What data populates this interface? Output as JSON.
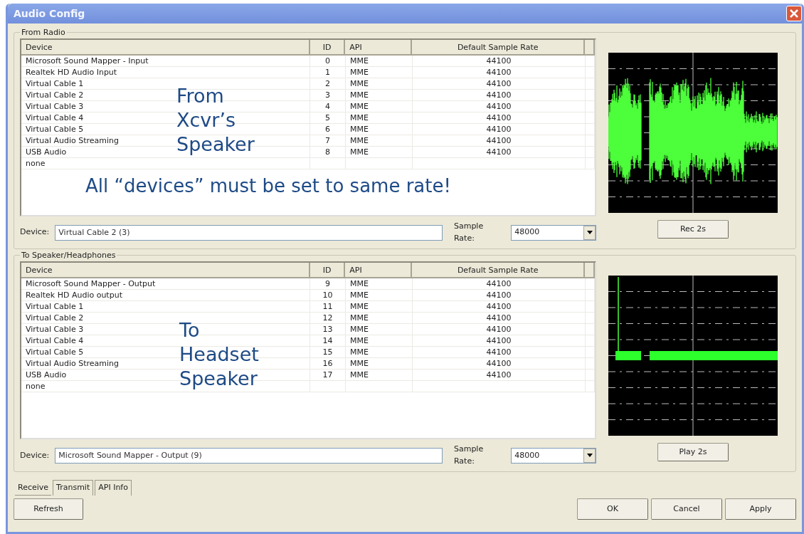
{
  "window": {
    "title": "Audio Config"
  },
  "sections": [
    {
      "title": "From Radio",
      "columns": [
        "Device",
        "ID",
        "API",
        "Default Sample Rate"
      ],
      "rows": [
        {
          "device": "Microsoft Sound Mapper - Input",
          "id": "0",
          "api": "MME",
          "rate": "44100"
        },
        {
          "device": "Realtek HD Audio Input",
          "id": "1",
          "api": "MME",
          "rate": "44100"
        },
        {
          "device": "Virtual Cable 1",
          "id": "2",
          "api": "MME",
          "rate": "44100"
        },
        {
          "device": "Virtual Cable 2",
          "id": "3",
          "api": "MME",
          "rate": "44100"
        },
        {
          "device": "Virtual Cable 3",
          "id": "4",
          "api": "MME",
          "rate": "44100"
        },
        {
          "device": "Virtual Cable 4",
          "id": "5",
          "api": "MME",
          "rate": "44100"
        },
        {
          "device": "Virtual Cable 5",
          "id": "6",
          "api": "MME",
          "rate": "44100"
        },
        {
          "device": "Virtual Audio Streaming",
          "id": "7",
          "api": "MME",
          "rate": "44100"
        },
        {
          "device": "USB Audio",
          "id": "8",
          "api": "MME",
          "rate": "44100"
        },
        {
          "device": "none"
        }
      ],
      "note_lines": [
        "From",
        "Xcvr’s",
        "Speaker"
      ],
      "banner": "All “devices” must be set to same rate!",
      "device_label": "Device:",
      "device_value": "Virtual Cable 2 (3)",
      "rate_label": "Sample Rate:",
      "rate_value": "48000",
      "scope": {
        "kind": "noise"
      },
      "button": "Rec 2s"
    },
    {
      "title": "To Speaker/Headphones",
      "columns": [
        "Device",
        "ID",
        "API",
        "Default Sample Rate"
      ],
      "rows": [
        {
          "device": "Microsoft Sound Mapper - Output",
          "id": "9",
          "api": "MME",
          "rate": "44100"
        },
        {
          "device": "Realtek HD Audio output",
          "id": "10",
          "api": "MME",
          "rate": "44100"
        },
        {
          "device": "Virtual Cable 1",
          "id": "11",
          "api": "MME",
          "rate": "44100"
        },
        {
          "device": "Virtual Cable 2",
          "id": "12",
          "api": "MME",
          "rate": "44100"
        },
        {
          "device": "Virtual Cable 3",
          "id": "13",
          "api": "MME",
          "rate": "44100"
        },
        {
          "device": "Virtual Cable 4",
          "id": "14",
          "api": "MME",
          "rate": "44100"
        },
        {
          "device": "Virtual Cable 5",
          "id": "15",
          "api": "MME",
          "rate": "44100"
        },
        {
          "device": "Virtual Audio Streaming",
          "id": "16",
          "api": "MME",
          "rate": "44100"
        },
        {
          "device": "USB Audio",
          "id": "17",
          "api": "MME",
          "rate": "44100"
        },
        {
          "device": "none"
        }
      ],
      "note_lines": [
        "To",
        "Headset",
        "Speaker"
      ],
      "device_label": "Device:",
      "device_value": "Microsoft Sound Mapper - Output (9)",
      "rate_label": "Sample Rate:",
      "rate_value": "48000",
      "scope": {
        "kind": "flat"
      },
      "button": "Play 2s"
    }
  ],
  "tabs": [
    {
      "label": "Receive",
      "selected": true
    },
    {
      "label": "Transmit",
      "selected": false
    },
    {
      "label": "API Info",
      "selected": false
    }
  ],
  "left_buttons": [
    "Refresh"
  ],
  "right_buttons": [
    "OK",
    "Cancel",
    "Apply"
  ]
}
